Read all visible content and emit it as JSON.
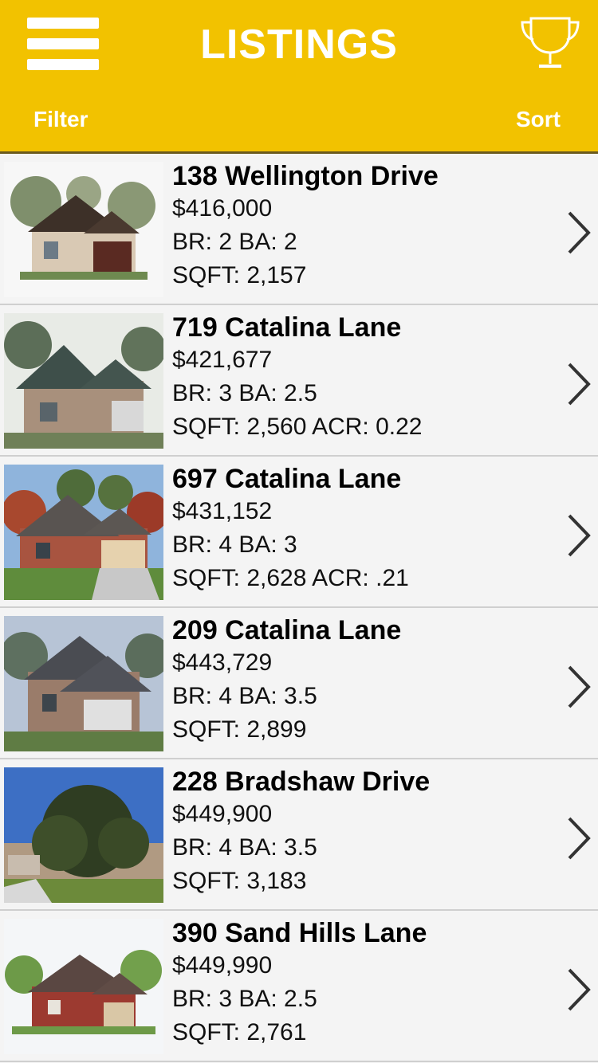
{
  "header": {
    "title": "LISTINGS",
    "filter_label": "Filter",
    "sort_label": "Sort",
    "menu_icon": "hamburger-menu-icon",
    "trophy_icon": "trophy-icon",
    "background_color": "#f2c200"
  },
  "listings": [
    {
      "address": "138 Wellington Drive",
      "price": "$416,000",
      "rooms": "BR: 2 BA: 2",
      "size": "SQFT: 2,157"
    },
    {
      "address": "719 Catalina Lane",
      "price": "$421,677",
      "rooms": "BR: 3 BA: 2.5",
      "size": "SQFT: 2,560 ACR: 0.22"
    },
    {
      "address": "697 Catalina Lane",
      "price": "$431,152",
      "rooms": "BR: 4 BA: 3",
      "size": "SQFT: 2,628 ACR: .21"
    },
    {
      "address": "209 Catalina Lane",
      "price": "$443,729",
      "rooms": "BR: 4 BA: 3.5",
      "size": "SQFT: 2,899"
    },
    {
      "address": "228 Bradshaw Drive",
      "price": "$449,900",
      "rooms": "BR: 4 BA: 3.5",
      "size": "SQFT: 3,183"
    },
    {
      "address": "390 Sand Hills Lane",
      "price": "$449,990",
      "rooms": "BR: 3 BA: 2.5",
      "size": "SQFT: 2,761"
    }
  ]
}
